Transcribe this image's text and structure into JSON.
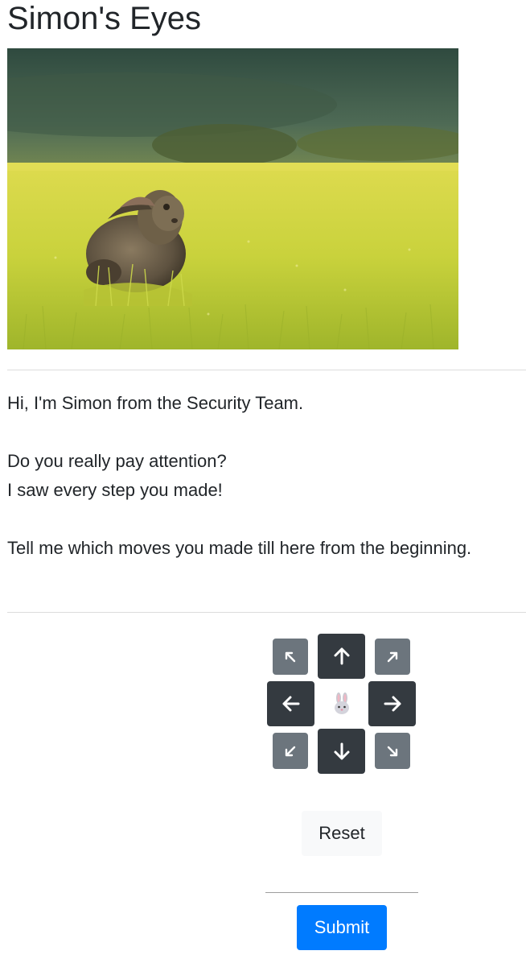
{
  "page": {
    "title": "Simon's Eyes"
  },
  "message": {
    "line1": "Hi, I'm Simon from the Security Team.",
    "line2": "Do you really pay attention?",
    "line3": "I saw every step you made!",
    "line4": "Tell me which moves you made till here from the beginning."
  },
  "controls": {
    "center_icon": "rabbit-icon",
    "buttons": [
      {
        "name": "up-left",
        "icon": "arrow-up-left-icon"
      },
      {
        "name": "up",
        "icon": "arrow-up-icon"
      },
      {
        "name": "up-right",
        "icon": "arrow-up-right-icon"
      },
      {
        "name": "left",
        "icon": "arrow-left-icon"
      },
      {
        "name": "right",
        "icon": "arrow-right-icon"
      },
      {
        "name": "down-left",
        "icon": "arrow-down-left-icon"
      },
      {
        "name": "down",
        "icon": "arrow-down-icon"
      },
      {
        "name": "down-right",
        "icon": "arrow-down-right-icon"
      }
    ],
    "reset_label": "Reset",
    "submit_label": "Submit"
  },
  "colors": {
    "diagonal_button": "#6c757d",
    "main_button": "#343a40",
    "reset_button": "#f8f9fa",
    "submit_button": "#007bff"
  }
}
